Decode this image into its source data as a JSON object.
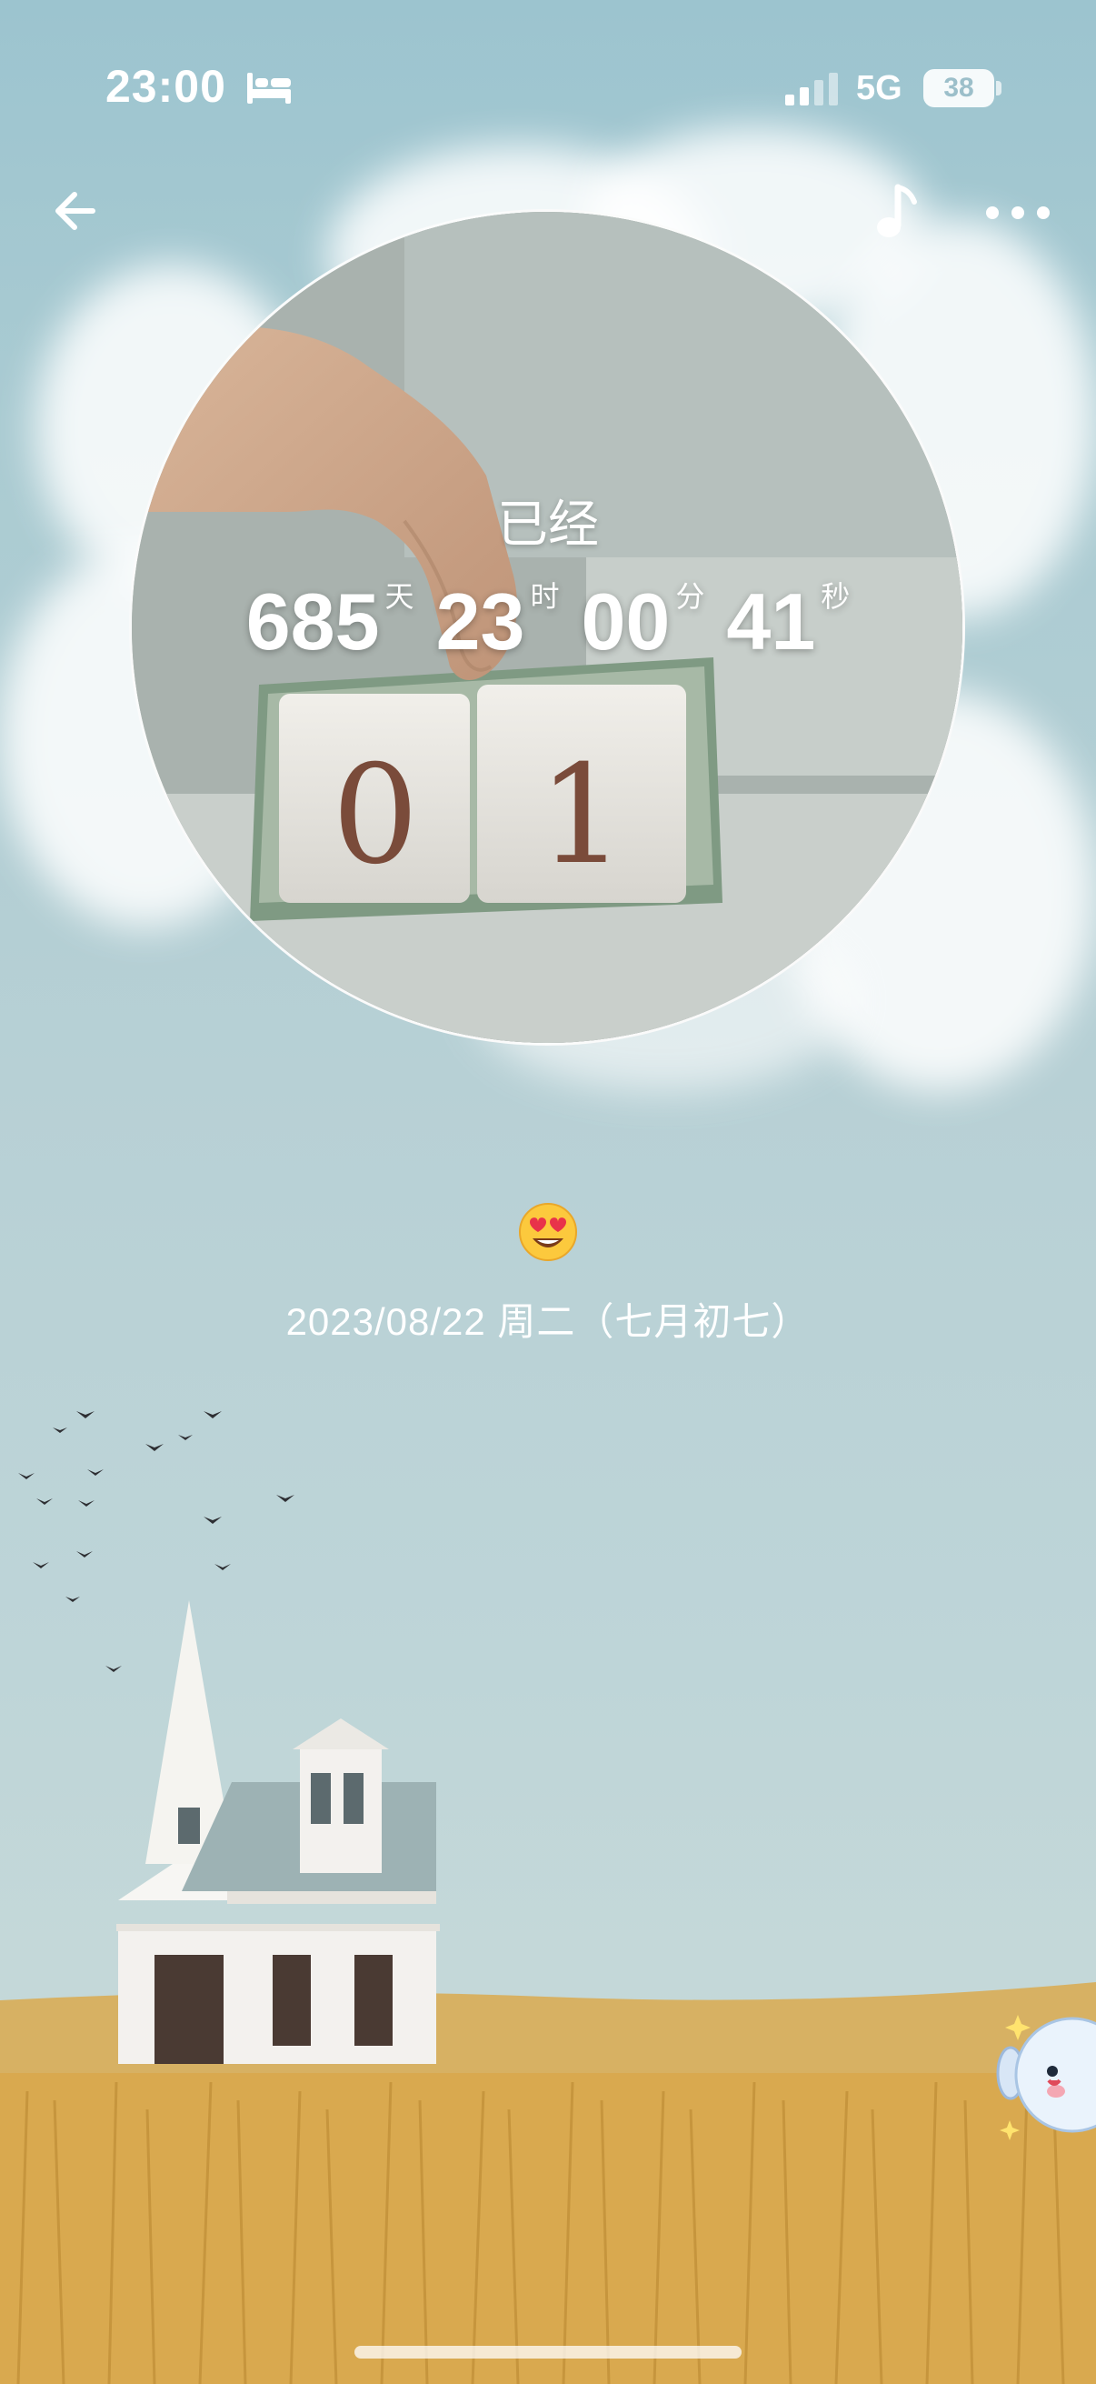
{
  "status_bar": {
    "time": "23:00",
    "network": "5G",
    "battery": "38"
  },
  "counter": {
    "label": "已经",
    "days": "685",
    "days_unit": "天",
    "hours": "23",
    "hours_unit": "时",
    "minutes": "00",
    "minutes_unit": "分",
    "seconds": "41",
    "seconds_unit": "秒"
  },
  "photo": {
    "digits": [
      "0",
      "1"
    ]
  },
  "mood": {
    "emoji": "😍"
  },
  "date": {
    "text": "2023/08/22 周二（七月初七）"
  },
  "icons": {
    "back": "back-arrow-icon",
    "music": "music-note-icon",
    "more": "more-dots-icon",
    "bed": "bed-icon",
    "signal": "signal-icon",
    "battery": "battery-icon"
  },
  "colors": {
    "sky": "#9cc4cf",
    "wheat": "#d9b165",
    "text": "#ffffff"
  }
}
